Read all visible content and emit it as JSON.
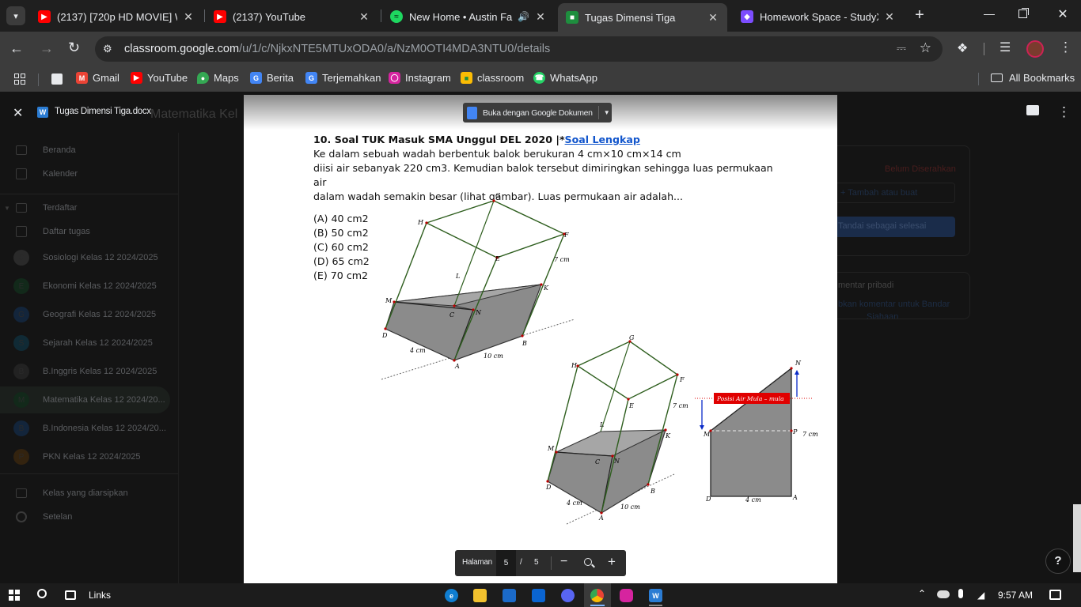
{
  "tabs": [
    {
      "title": "(2137) [720p HD MOVIE] Wa",
      "icon": "youtube-icon",
      "color": "#ff0000"
    },
    {
      "title": "(2137) YouTube",
      "icon": "youtube-icon",
      "color": "#ff0000"
    },
    {
      "title": "New Home • Austin Farw",
      "icon": "spotify-icon",
      "color": "#1ed760"
    },
    {
      "title": "Tugas Dimensi Tiga",
      "icon": "classroom-icon",
      "color": "#1e8e3e"
    },
    {
      "title": "Homework Space - StudyX",
      "icon": "studyx-icon",
      "color": "#7c4dff"
    }
  ],
  "address": {
    "domain": "classroom.google.com",
    "path": "/u/1/c/NjkxNTE5MTUxODA0/a/NzM0OTI4MDA3NTU0/details"
  },
  "bookmarks": [
    {
      "label": "Gmail",
      "icon": "gmail-icon",
      "color": "#ea4335"
    },
    {
      "label": "YouTube",
      "icon": "youtube-icon",
      "color": "#ff0000"
    },
    {
      "label": "Maps",
      "icon": "maps-icon",
      "color": "#34a853"
    },
    {
      "label": "Berita",
      "icon": "news-icon",
      "color": "#4285f4"
    },
    {
      "label": "Terjemahkan",
      "icon": "translate-icon",
      "color": "#4285f4"
    },
    {
      "label": "Instagram",
      "icon": "instagram-icon",
      "color": "#d6249f"
    },
    {
      "label": "classroom",
      "icon": "classroom-icon",
      "color": "#fbbc04"
    },
    {
      "label": "WhatsApp",
      "icon": "whatsapp-icon",
      "color": "#25d366"
    }
  ],
  "all_bookmarks": "All Bookmarks",
  "viewer": {
    "file_name": "Tugas Dimensi Tiga.docx",
    "behind_title": "Matematika Kel",
    "open_with": "Buka dengan Google Dokumen",
    "page_label": "Halaman",
    "page_current": "5",
    "page_sep": "/",
    "page_total": "5"
  },
  "sidebar": [
    {
      "label": "Beranda",
      "icon": "home-icon"
    },
    {
      "label": "Kalender",
      "icon": "calendar-icon"
    },
    {
      "label": "Terdaftar",
      "icon": "enrolled-icon"
    },
    {
      "label": "Daftar tugas",
      "icon": "todo-icon"
    },
    {
      "label": "Sosiologi Kelas 12 2024/2025",
      "initial": "S",
      "color": "#4a4a4a"
    },
    {
      "label": "Ekonomi Kelas 12 2024/2025",
      "initial": "E",
      "color": "#1e4a2a"
    },
    {
      "label": "Geografi Kelas 12 2024/2025",
      "initial": "G",
      "color": "#1d3d63"
    },
    {
      "label": "Sejarah Kelas 12 2024/2025",
      "initial": "S",
      "color": "#1a4a5c"
    },
    {
      "label": "B.Inggris Kelas 12 2024/2025",
      "initial": "B",
      "color": "#333"
    },
    {
      "label": "Matematika Kelas 12 2024/20...",
      "initial": "M",
      "color": "#1e4a2a"
    },
    {
      "label": "B.Indonesia Kelas 12 2024/20...",
      "initial": "B",
      "color": "#1d3d63"
    },
    {
      "label": "PKN Kelas 12 2024/2025",
      "initial": "P",
      "color": "#5a3a1a"
    },
    {
      "label": "Kelas yang diarsipkan",
      "icon": "archive-icon"
    },
    {
      "label": "Setelan",
      "icon": "settings-icon"
    }
  ],
  "right_panel": {
    "status": "Belum Diserahkan",
    "add": "+ Tambah atau buat",
    "mark_done": "Tandai sebagai selesai",
    "private_comments": "mentar pribadi",
    "add_comment": "bkan komentar untuk Bandar",
    "add_comment2": "Siahaan"
  },
  "document": {
    "heading_prefix": "10. Soal TUK Masuk SMA Unggul DEL 2020 |*",
    "heading_link": "Soal Lengkap",
    "line1": "Ke dalam sebuah wadah berbentuk balok berukuran 4 cm×10 cm×14 cm",
    "line2": "diisi air sebanyak 220 cm3. Kemudian balok tersebut dimiringkan sehingga luas permukaan air",
    "line3": "dalam wadah semakin besar (lihat gambar). Luas permukaan air adalah...",
    "options": [
      "(A) 40 cm2",
      "(B) 50 cm2",
      "(C) 60 cm2",
      "(D) 65 cm2",
      "(E) 70 cm2"
    ],
    "fig1": {
      "G": "G",
      "H": "H",
      "F": "F",
      "E": "E",
      "L": "L",
      "M": "M",
      "K": "K",
      "C": "C",
      "N": "N",
      "D": "D",
      "B": "B",
      "A": "A",
      "side": "7 cm",
      "w": "4 cm",
      "l": "10 cm"
    },
    "fig2": {
      "G": "G",
      "H": "H",
      "F": "F",
      "E": "E",
      "L": "L",
      "M": "M",
      "K": "K",
      "C": "C",
      "N": "N",
      "D": "D",
      "B": "B",
      "A": "A",
      "side": "7 cm",
      "w": "4 cm",
      "l": "10 cm"
    },
    "fig3": {
      "label": "Posisi Air Mula – mula",
      "N": "N",
      "M": "M",
      "P": "P",
      "D": "D",
      "A": "A",
      "side": "7 cm",
      "w": "4 cm"
    }
  },
  "taskbar": {
    "search_label": "Links",
    "time": "9:57 AM"
  }
}
